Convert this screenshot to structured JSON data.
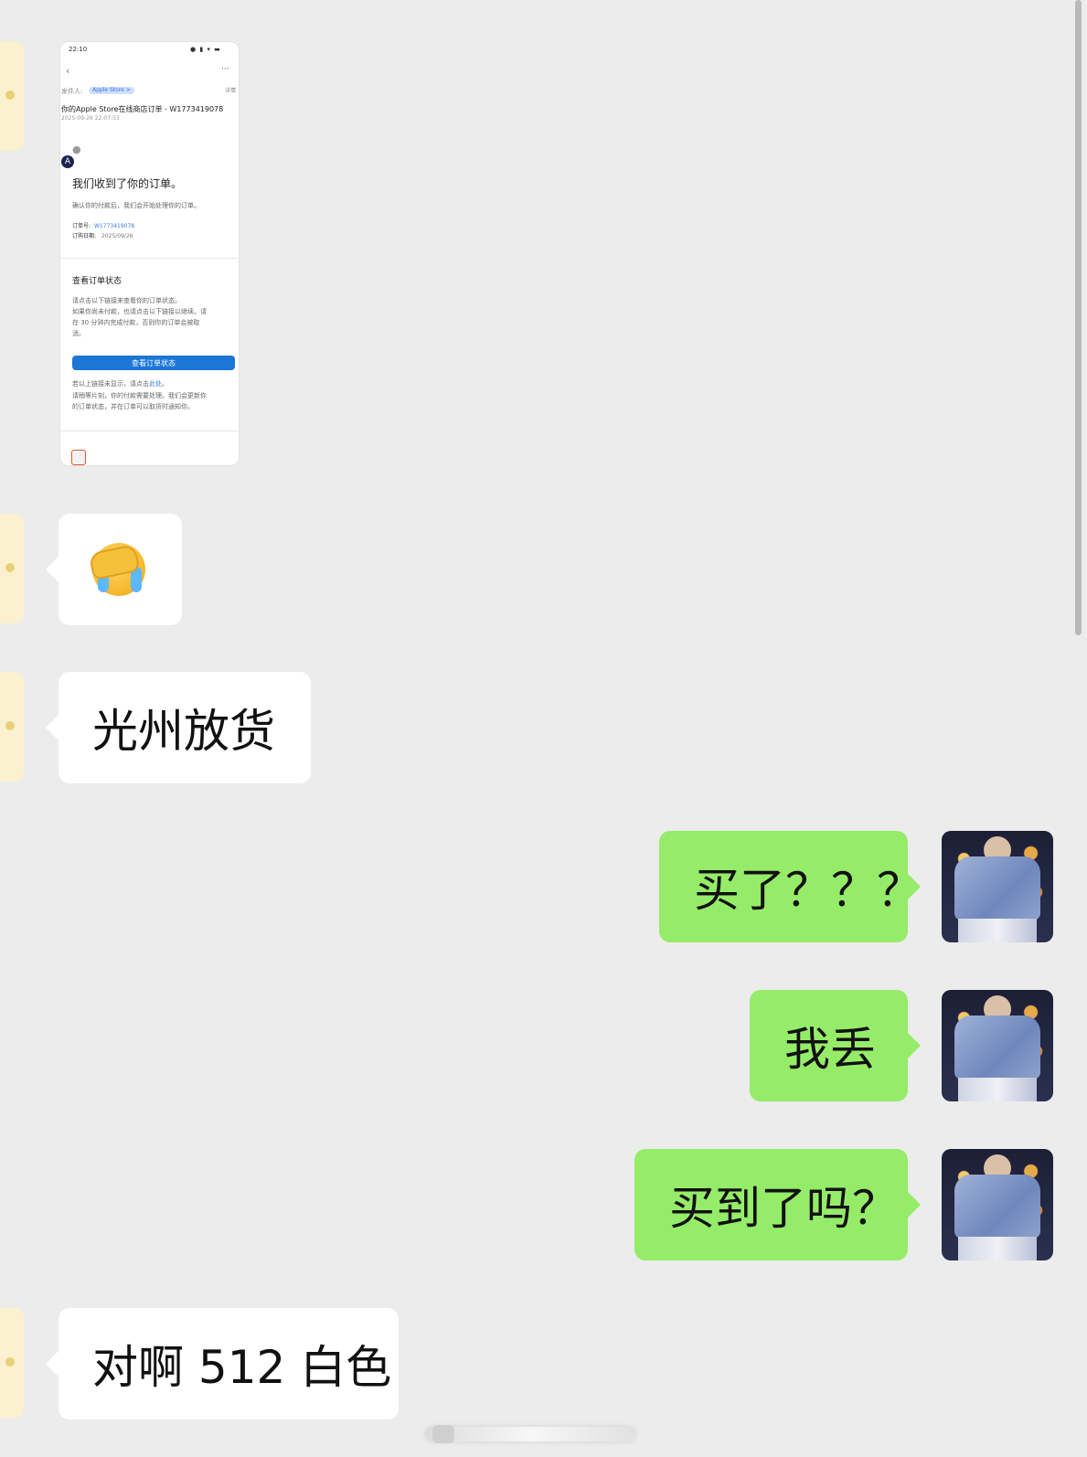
{
  "screenshot": {
    "status_time": "22:10",
    "sender_label": "发件人:",
    "sender_name": "Apple Store >",
    "detail_label": "详情",
    "subject": "你的Apple Store在线商店订单 - W1773419078",
    "date_time": "2025-09-26 22:07:53",
    "heading": "我们收到了你的订单。",
    "intro": "确认你的付款后，我们会开始处理你的订单。",
    "order_no_label": "订单号:",
    "order_no": "W1773419078",
    "order_date_label": "订购日期:",
    "order_date": "2025/09/26",
    "status_heading": "查看订单状态",
    "status_text_1": "请点击以下链接来查看你的订单状态。",
    "status_text_2": "如果你尚未付款，也请点击以下链接以继续。请",
    "status_text_3": "在 30 分钟内完成付款，否则你的订单会被取",
    "status_text_4": "消。",
    "status_button": "查看订单状态",
    "footer_1a": "若以上链接未显示，请点击",
    "footer_1b": "此处",
    "footer_1c": "。",
    "footer_2": "请稍等片刻，你的付款需要处理。我们会更新你",
    "footer_3": "的订单状态，并在订单可以取货时通知你。"
  },
  "messages": [
    {
      "side": "left",
      "text": "光州放货"
    },
    {
      "side": "right",
      "text": "买了？？？"
    },
    {
      "side": "right",
      "text": "我丢"
    },
    {
      "side": "right",
      "text": "买到了吗？"
    },
    {
      "side": "left",
      "text": "对啊 512 白色"
    }
  ],
  "emoji_message": {
    "icon": "face-palm-crying-emoji"
  },
  "colors": {
    "background": "#ececec",
    "sent_bubble": "#95ec69",
    "received_bubble": "#ffffff"
  }
}
